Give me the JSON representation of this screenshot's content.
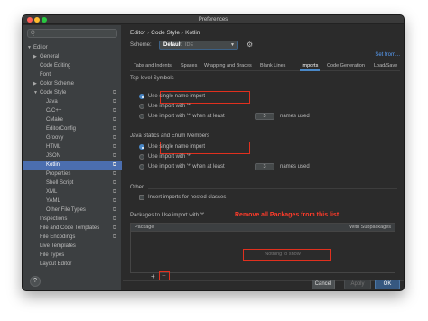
{
  "window": {
    "title": "Preferences"
  },
  "sidebar": {
    "search_placeholder": "Q",
    "items": [
      {
        "label": "Editor",
        "arrow": "▼"
      },
      {
        "label": "General",
        "arrow": "▶"
      },
      {
        "label": "Code Editing",
        "arrow": ""
      },
      {
        "label": "Font",
        "arrow": ""
      },
      {
        "label": "Color Scheme",
        "arrow": "▶"
      },
      {
        "label": "Code Style",
        "arrow": "▼"
      },
      {
        "label": "Java",
        "arrow": ""
      },
      {
        "label": "C/C++",
        "arrow": ""
      },
      {
        "label": "CMake",
        "arrow": ""
      },
      {
        "label": "EditorConfig",
        "arrow": ""
      },
      {
        "label": "Groovy",
        "arrow": ""
      },
      {
        "label": "HTML",
        "arrow": ""
      },
      {
        "label": "JSON",
        "arrow": ""
      },
      {
        "label": "Kotlin",
        "arrow": ""
      },
      {
        "label": "Properties",
        "arrow": ""
      },
      {
        "label": "Shell Script",
        "arrow": ""
      },
      {
        "label": "XML",
        "arrow": ""
      },
      {
        "label": "YAML",
        "arrow": ""
      },
      {
        "label": "Other File Types",
        "arrow": ""
      },
      {
        "label": "Inspections",
        "arrow": ""
      },
      {
        "label": "File and Code Templates",
        "arrow": ""
      },
      {
        "label": "File Encodings",
        "arrow": ""
      },
      {
        "label": "Live Templates",
        "arrow": ""
      },
      {
        "label": "File Types",
        "arrow": ""
      },
      {
        "label": "Layout Editor",
        "arrow": ""
      }
    ],
    "selected": "Kotlin"
  },
  "breadcrumb": {
    "part1": "Editor",
    "separator": "›",
    "part2": "Code Style",
    "part3": "Kotlin"
  },
  "scheme": {
    "label": "Scheme:",
    "value": "Default",
    "suffix": "IDE",
    "set_from": "Set from..."
  },
  "tabs": [
    "Tabs and Indents",
    "Spaces",
    "Wrapping and Braces",
    "Blank Lines",
    "Imports",
    "Code Generation",
    "Load/Save"
  ],
  "active_tab": "Imports",
  "top_level": {
    "title": "Top-level Symbols",
    "opt1": "Use single name import",
    "opt2": "Use import with '*'",
    "opt3": "Use import with '*' when at least",
    "count": "5",
    "names_used": "names used"
  },
  "java_statics": {
    "title": "Java Statics and Enum Members",
    "opt1": "Use single name import",
    "opt2": "Use import with '*'",
    "opt3": "Use import with '*' when at least",
    "count": "3",
    "names_used": "names used"
  },
  "other": {
    "title": "Other",
    "checkbox_label": "Insert imports for nested classes"
  },
  "packages": {
    "title": "Packages to Use import with '*'",
    "annotation": "Remove all Packages from this list",
    "col_package": "Package",
    "col_subpackages": "With Subpackages",
    "empty": "Nothing to show",
    "add": "+",
    "remove": "−"
  },
  "footer": {
    "help": "?",
    "cancel": "Cancel",
    "apply": "Apply",
    "ok": "OK"
  }
}
